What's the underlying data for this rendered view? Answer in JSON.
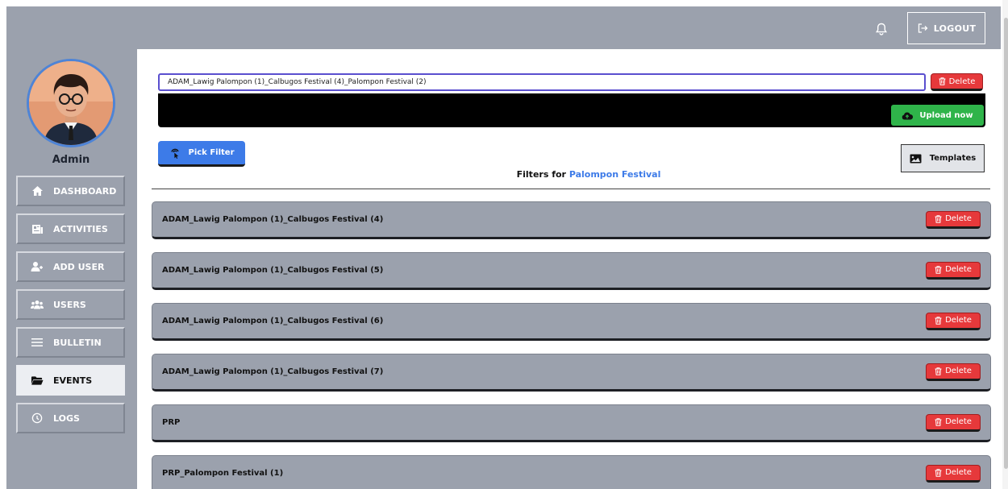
{
  "header": {
    "notification_icon": "bell-icon",
    "logout_label": "LOGOUT",
    "logout_icon": "logout-arrow-icon"
  },
  "sidebar": {
    "user_name": "Admin",
    "items": [
      {
        "label": "DASHBOARD",
        "icon": "home-icon",
        "active": false
      },
      {
        "label": "ACTIVITIES",
        "icon": "newspaper-icon",
        "active": false
      },
      {
        "label": "ADD USER",
        "icon": "user-plus-icon",
        "active": false
      },
      {
        "label": "USERS",
        "icon": "users-icon",
        "active": false
      },
      {
        "label": "BULLETIN",
        "icon": "bars-icon",
        "active": false
      },
      {
        "label": "EVENTS",
        "icon": "folder-icon",
        "active": true
      },
      {
        "label": "LOGS",
        "icon": "clock-icon",
        "active": false
      }
    ]
  },
  "upload": {
    "filename_value": "ADAM_Lawig Palompon (1)_Calbugos Festival (4)_Palompon Festival (2)",
    "delete_label": "Delete",
    "upload_label": "Upload now"
  },
  "actions": {
    "pick_filter_label": "Pick Filter",
    "templates_label": "Templates"
  },
  "filters_heading": {
    "prefix": "Filters for ",
    "event_name": "Palompon Festival"
  },
  "filters": [
    {
      "name": "ADAM_Lawig Palompon (1)_Calbugos Festival (4)",
      "delete_label": "Delete"
    },
    {
      "name": "ADAM_Lawig Palompon (1)_Calbugos Festival (5)",
      "delete_label": "Delete"
    },
    {
      "name": "ADAM_Lawig Palompon (1)_Calbugos Festival (6)",
      "delete_label": "Delete"
    },
    {
      "name": "ADAM_Lawig Palompon (1)_Calbugos Festival (7)",
      "delete_label": "Delete"
    },
    {
      "name": "PRP",
      "delete_label": "Delete"
    },
    {
      "name": "PRP_Palompon Festival (1)",
      "delete_label": "Delete"
    }
  ],
  "colors": {
    "app_background": "#9ba1ad",
    "accent_blue": "#3d7be8",
    "delete_red": "#e6393b",
    "upload_green": "#2fb44a",
    "input_border": "#5a4fcf"
  }
}
